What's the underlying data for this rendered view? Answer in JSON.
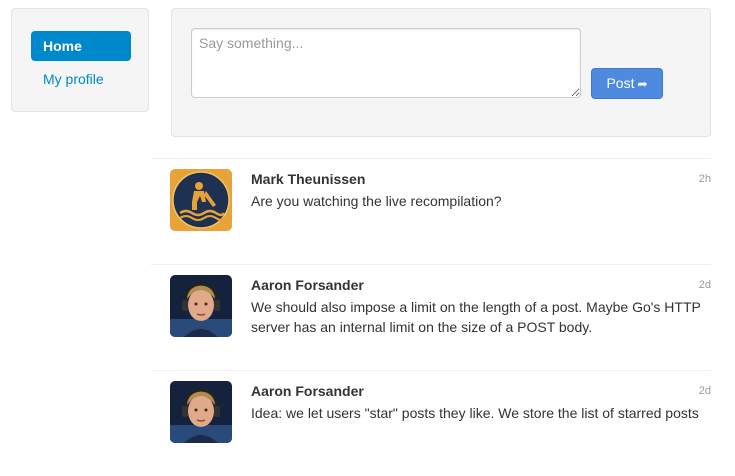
{
  "sidebar": {
    "items": [
      {
        "label": "Home",
        "active": true
      },
      {
        "label": "My profile",
        "active": false
      }
    ]
  },
  "composer": {
    "placeholder": "Say something...",
    "value": "",
    "post_label": "Post"
  },
  "feed": {
    "posts": [
      {
        "author": "Mark Theunissen",
        "time": "2h",
        "text": "Are you watching the live recompilation?",
        "avatar": "construction-worker-avatar"
      },
      {
        "author": "Aaron Forsander",
        "time": "2d",
        "text": "We should also impose a limit on the length of a post. Maybe Go's HTTP server has an internal limit on the size of a POST body.",
        "avatar": "headphones-person-avatar"
      },
      {
        "author": "Aaron Forsander",
        "time": "2d",
        "text": "Idea: we let users \"star\" posts they like. We store the list of starred posts",
        "avatar": "headphones-person-avatar"
      }
    ]
  },
  "colors": {
    "primary": "#0088cc",
    "post_button": "#4d8ae0",
    "panel_bg": "#f5f5f5",
    "muted": "#999999"
  }
}
